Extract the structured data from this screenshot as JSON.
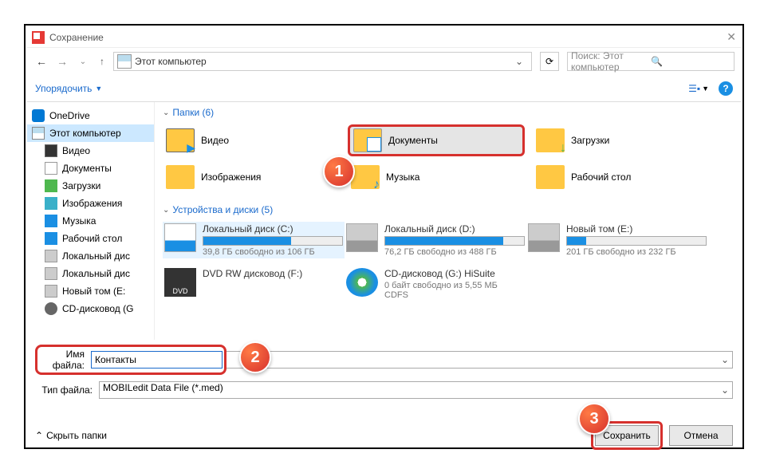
{
  "window": {
    "title": "Сохранение"
  },
  "nav": {
    "location": "Этот компьютер",
    "search_placeholder": "Поиск: Этот компьютер"
  },
  "toolbar": {
    "organize": "Упорядочить"
  },
  "sidebar": {
    "items": [
      {
        "label": "OneDrive",
        "cls": "cloud"
      },
      {
        "label": "Этот компьютер",
        "cls": "pc",
        "sel": true
      },
      {
        "label": "Видео",
        "cls": "vid",
        "sub": true
      },
      {
        "label": "Документы",
        "cls": "doc",
        "sub": true
      },
      {
        "label": "Загрузки",
        "cls": "dwn",
        "sub": true
      },
      {
        "label": "Изображения",
        "cls": "img",
        "sub": true
      },
      {
        "label": "Музыка",
        "cls": "mus",
        "sub": true
      },
      {
        "label": "Рабочий стол",
        "cls": "desk",
        "sub": true
      },
      {
        "label": "Локальный дис",
        "cls": "drv",
        "sub": true
      },
      {
        "label": "Локальный дис",
        "cls": "drv",
        "sub": true
      },
      {
        "label": "Новый том (E:",
        "cls": "drv",
        "sub": true
      },
      {
        "label": "CD-дисковод (G",
        "cls": "cd",
        "sub": true
      }
    ]
  },
  "groups": {
    "folders_hdr": "Папки (6)",
    "folders": [
      {
        "label": "Видео",
        "cls": "vid"
      },
      {
        "label": "Документы",
        "cls": "doc",
        "hl": true
      },
      {
        "label": "Загрузки",
        "cls": "dwn"
      },
      {
        "label": "Изображения",
        "cls": "img"
      },
      {
        "label": "Музыка",
        "cls": "mus"
      },
      {
        "label": "Рабочий стол",
        "cls": "desk"
      }
    ],
    "drives_hdr": "Устройства и диски (5)",
    "drives": [
      {
        "name": "Локальный диск (C:)",
        "free": "39,8 ГБ свободно из 106 ГБ",
        "pct": 63,
        "sel": true,
        "icon": "win"
      },
      {
        "name": "Локальный диск (D:)",
        "free": "76,2 ГБ свободно из 488 ГБ",
        "pct": 85,
        "icon": "hdd"
      },
      {
        "name": "Новый том (E:)",
        "free": "201 ГБ свободно из 232 ГБ",
        "pct": 14,
        "icon": "hdd"
      },
      {
        "name": "DVD RW дисковод (F:)",
        "free": "",
        "icon": "dvd",
        "nobar": true
      },
      {
        "name": "CD-дисковод (G:) HiSuite",
        "free": "0 байт свободно из 5,55 МБ",
        "sub": "CDFS",
        "icon": "cd",
        "nobar": true
      }
    ]
  },
  "form": {
    "fname_lbl": "Имя файла:",
    "fname_val": "Контакты",
    "ftype_lbl": "Тип файла:",
    "ftype_val": "MOBILedit Data File (*.med)"
  },
  "footer": {
    "hide": "Скрыть папки",
    "save": "Сохранить",
    "cancel": "Отмена"
  },
  "callouts": {
    "c1": "1",
    "c2": "2",
    "c3": "3"
  }
}
